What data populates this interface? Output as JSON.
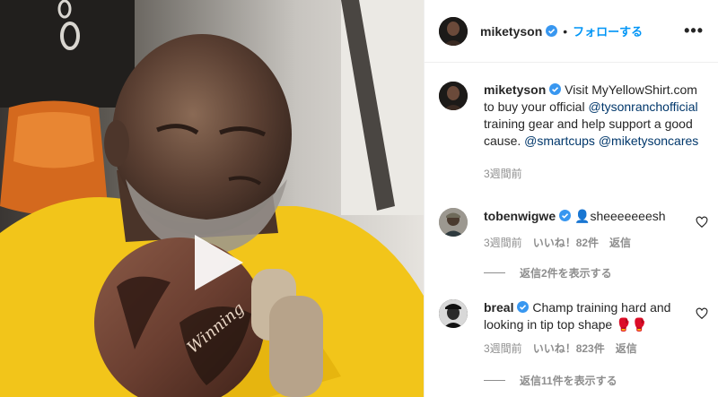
{
  "post": {
    "author": "miketyson",
    "follow_label": "フォローする",
    "separator": "•",
    "more_label": "•••",
    "play_icon": "play-icon"
  },
  "caption": {
    "author": "miketyson",
    "text_1": "Visit MyYellowShirt.com to buy your official",
    "mention_1": "@tysonranchofficial",
    "text_2": "training gear and help support a good cause.",
    "mention_2": "@smartcups",
    "mention_3": "@miketysoncares",
    "time": "3週間前"
  },
  "comments": [
    {
      "author": "tobenwigwe",
      "text": "👤sheeeeeeesh",
      "time": "3週間前",
      "likes": "いいね！82件",
      "reply": "返信",
      "view_replies": "返信2件を表示する"
    },
    {
      "author": "breal",
      "text": "Champ training hard and looking in tip top shape 🥊🥊",
      "time": "3週間前",
      "likes": "いいね！823件",
      "reply": "返信",
      "view_replies": "返信11件を表示する"
    }
  ],
  "colors": {
    "accent": "#0095f6",
    "verified": "#3897f0",
    "mention": "#00376b",
    "muted": "#8e8e8e",
    "shirt": "#f2c51a"
  }
}
